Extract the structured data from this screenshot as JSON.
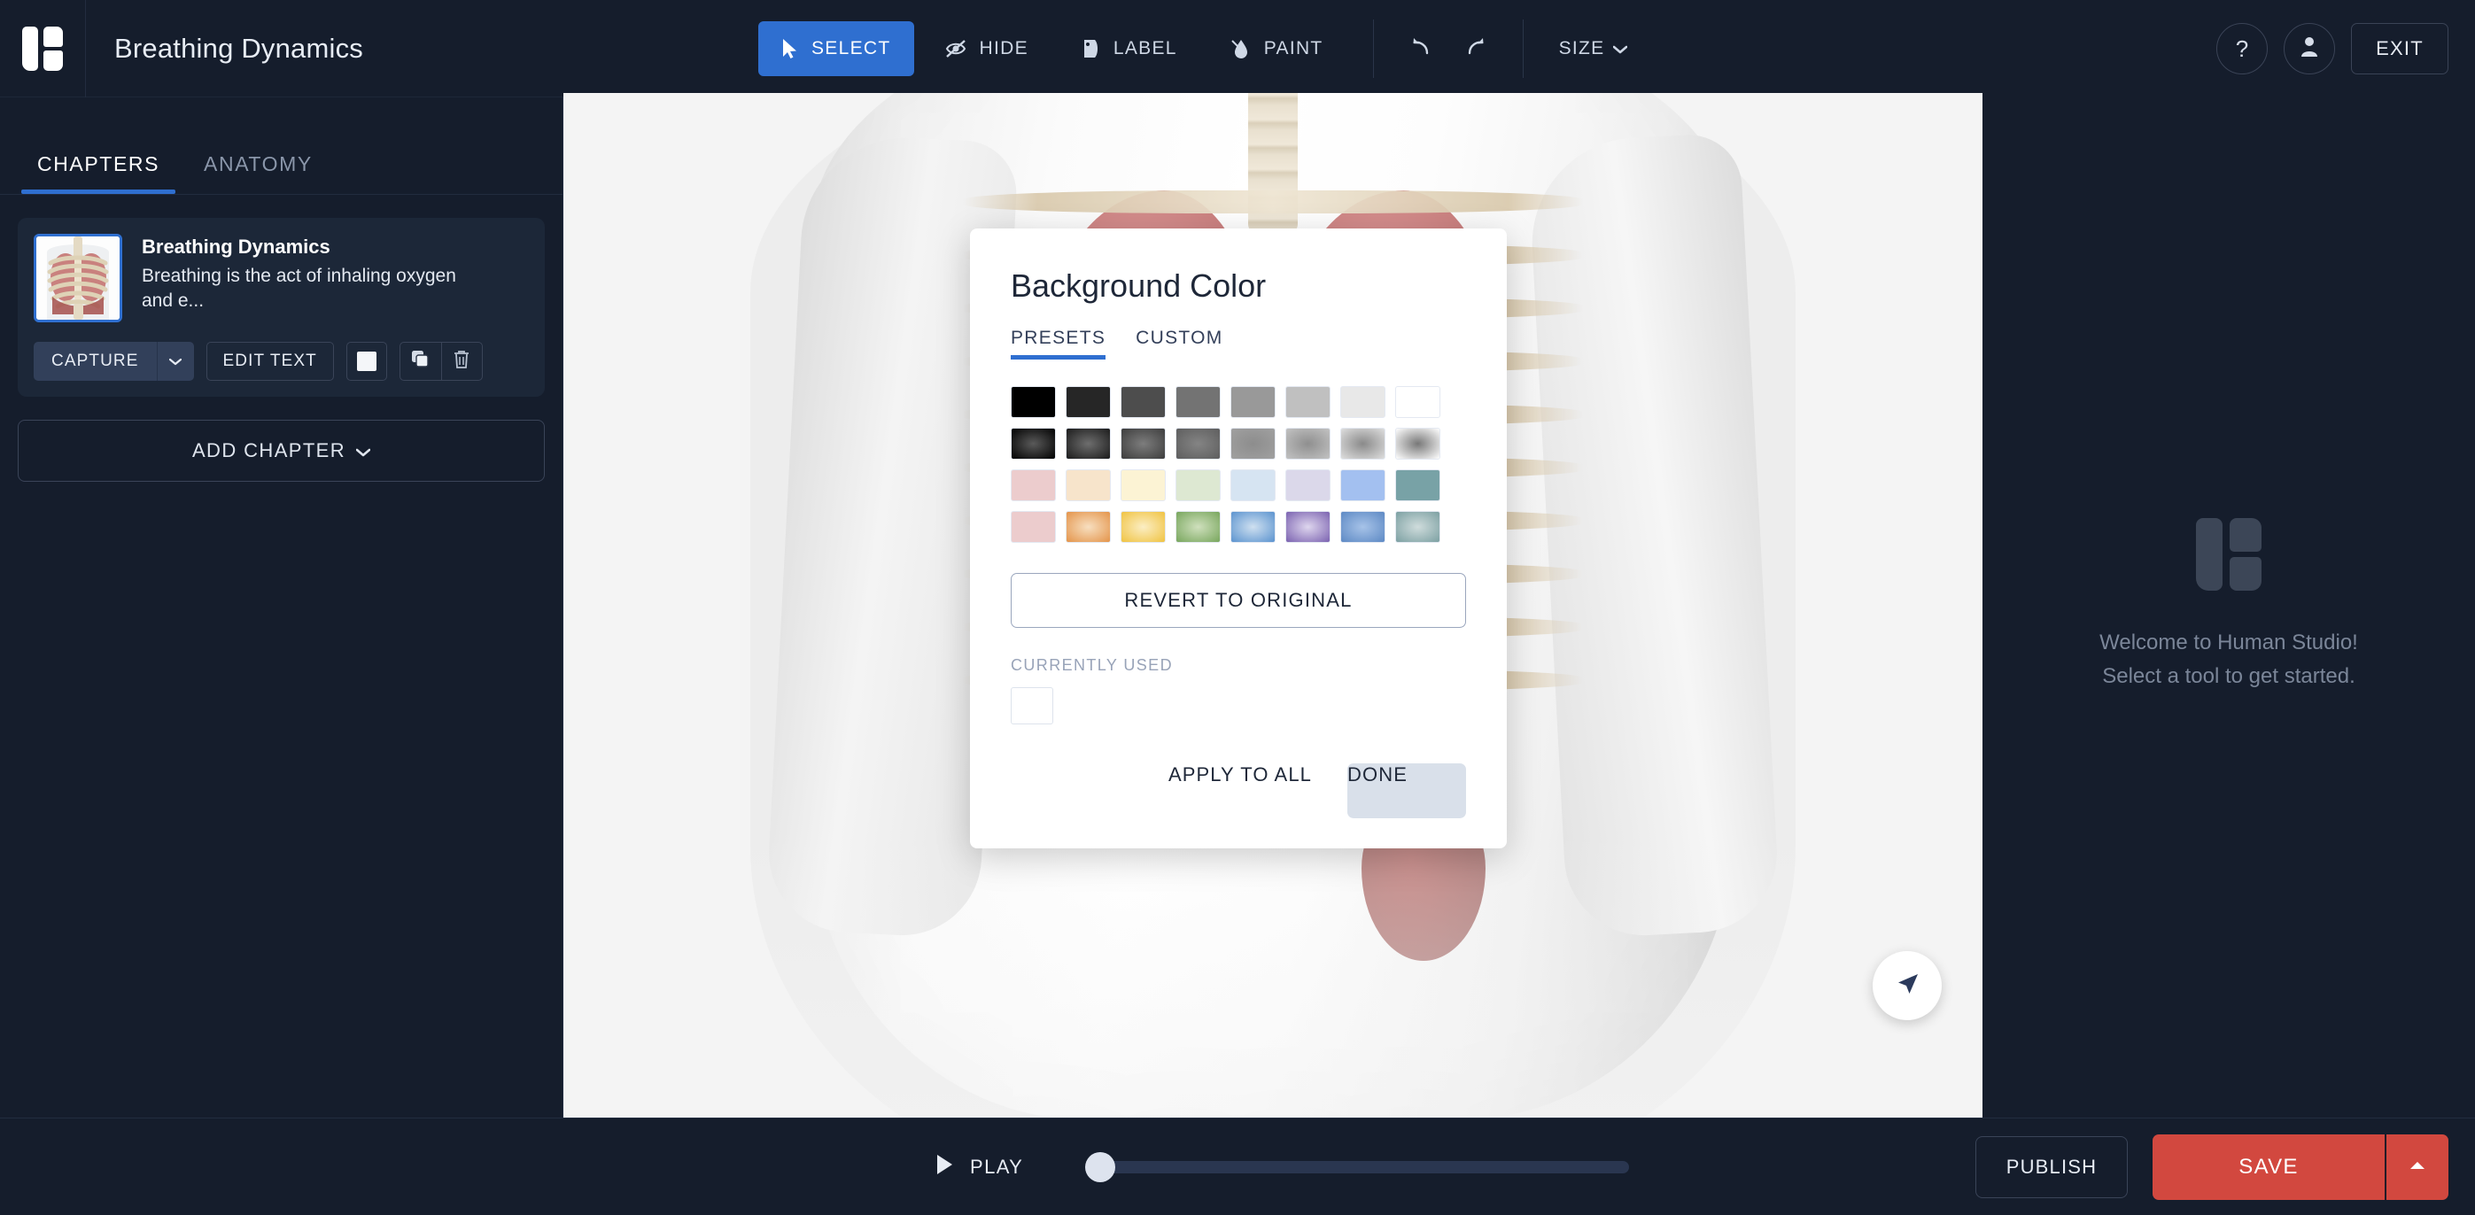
{
  "header": {
    "logo_icon": "human-studio-logo-icon",
    "title": "Breathing Dynamics",
    "tools": [
      {
        "id": "select",
        "label": "SELECT",
        "icon": "cursor-arrow-icon",
        "active": true
      },
      {
        "id": "hide",
        "label": "HIDE",
        "icon": "eye-slash-icon",
        "active": false
      },
      {
        "id": "label",
        "label": "LABEL",
        "icon": "tag-icon",
        "active": false
      },
      {
        "id": "paint",
        "label": "PAINT",
        "icon": "paint-drop-icon",
        "active": false
      }
    ],
    "undo_icon": "undo-arrow-icon",
    "redo_icon": "redo-arrow-icon",
    "size_label": "SIZE",
    "size_caret_icon": "chevron-down-icon",
    "help_icon": "question-mark-icon",
    "account_icon": "user-avatar-icon",
    "exit_label": "EXIT"
  },
  "sidebar": {
    "tabs": [
      {
        "label": "CHAPTERS",
        "active": true
      },
      {
        "label": "ANATOMY",
        "active": false
      }
    ],
    "chapter": {
      "thumbnail_icon": "chapter-thumbnail-ribcage-lungs",
      "title": "Breathing Dynamics",
      "description": "Breathing is the act of inhaling oxygen and e...",
      "capture_label": "CAPTURE",
      "capture_caret_icon": "chevron-down-icon",
      "edit_text_label": "EDIT TEXT",
      "background_color_icon": "background-color-swatch-icon",
      "duplicate_icon": "duplicate-icon",
      "delete_icon": "trash-icon"
    },
    "add_chapter_label": "ADD CHAPTER",
    "add_chapter_caret_icon": "chevron-down-icon"
  },
  "viewport": {
    "model_icon": "human-anatomy-3d-model",
    "nav_fab_icon": "navigation-arrow-icon",
    "background_color": "#f4f4f4"
  },
  "right_panel": {
    "logo_icon": "human-studio-logo-icon",
    "line1": "Welcome to Human Studio!",
    "line2": "Select a tool to get started."
  },
  "bottom_bar": {
    "play_icon": "play-triangle-icon",
    "play_label": "PLAY",
    "timeline_value": 0,
    "publish_label": "PUBLISH",
    "save_label": "SAVE",
    "save_caret_icon": "chevron-up-icon",
    "save_color": "#d2483f"
  },
  "modal": {
    "title": "Background Color",
    "tabs": [
      {
        "label": "PRESETS",
        "active": true
      },
      {
        "label": "CUSTOM",
        "active": false
      }
    ],
    "accent_color": "#2f6fd0",
    "swatch_rows": [
      [
        {
          "type": "solid",
          "color": "#000000"
        },
        {
          "type": "solid",
          "color": "#262626"
        },
        {
          "type": "solid",
          "color": "#4d4d4d"
        },
        {
          "type": "solid",
          "color": "#737373"
        },
        {
          "type": "solid",
          "color": "#999999"
        },
        {
          "type": "solid",
          "color": "#c0c0c0"
        },
        {
          "type": "solid",
          "color": "#e8e8e8"
        },
        {
          "type": "solid",
          "color": "#ffffff"
        }
      ],
      [
        {
          "type": "radial",
          "color": "#5a5a5a",
          "edge": "#000000"
        },
        {
          "type": "radial",
          "color": "#6e6e6e",
          "edge": "#1b1b1b"
        },
        {
          "type": "radial",
          "color": "#7d7d7d",
          "edge": "#3d3d3d"
        },
        {
          "type": "radial",
          "color": "#848484",
          "edge": "#5e5e5e"
        },
        {
          "type": "radial",
          "color": "#8d8d8d",
          "edge": "#a0a0a0"
        },
        {
          "type": "radial",
          "color": "#8f8f8f",
          "edge": "#c2c2c2"
        },
        {
          "type": "radial",
          "color": "#8a8a8a",
          "edge": "#dedede"
        },
        {
          "type": "radial",
          "color": "#787878",
          "edge": "#ffffff"
        }
      ],
      [
        {
          "type": "solid",
          "color": "#eccccd"
        },
        {
          "type": "solid",
          "color": "#f7e4cb"
        },
        {
          "type": "solid",
          "color": "#fcf3d4"
        },
        {
          "type": "solid",
          "color": "#dde8d2"
        },
        {
          "type": "solid",
          "color": "#d6e4f2"
        },
        {
          "type": "solid",
          "color": "#dbd8ea"
        },
        {
          "type": "solid",
          "color": "#a3c0f0"
        },
        {
          "type": "solid",
          "color": "#78a2a6"
        }
      ],
      [
        {
          "type": "solid",
          "color": "#eccccd"
        },
        {
          "type": "radial",
          "color": "#f7dfc0",
          "edge": "#e4944a"
        },
        {
          "type": "radial",
          "color": "#fbeec4",
          "edge": "#f0c342"
        },
        {
          "type": "radial",
          "color": "#cfe0bd",
          "edge": "#78a65d"
        },
        {
          "type": "radial",
          "color": "#cfe0f0",
          "edge": "#5b93cf"
        },
        {
          "type": "radial",
          "color": "#ded6ee",
          "edge": "#7b62b0"
        },
        {
          "type": "radial",
          "color": "#a7c3e8",
          "edge": "#5d89c4"
        },
        {
          "type": "radial",
          "color": "#cfdcdc",
          "edge": "#7ca0a2"
        }
      ]
    ],
    "revert_label": "REVERT TO ORIGINAL",
    "currently_used_label": "CURRENTLY USED",
    "currently_used_color": "#ffffff",
    "apply_to_all_label": "APPLY TO ALL",
    "done_label": "DONE"
  }
}
